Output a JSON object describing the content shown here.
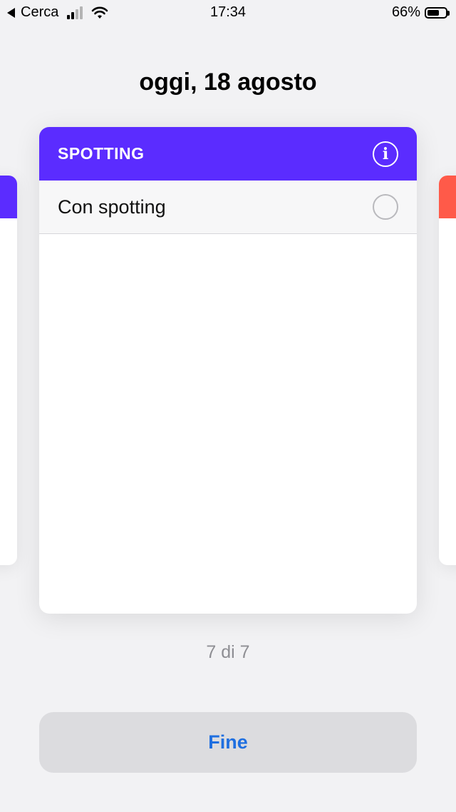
{
  "status_bar": {
    "back_app": "Cerca",
    "time": "17:34",
    "battery_text": "66%",
    "battery_level": 0.66
  },
  "date_title": "oggi, 18 agosto",
  "card": {
    "title": "SPOTTING",
    "header_color": "#5b2cff",
    "info_icon": "info-icon",
    "options": [
      {
        "label": "Con spotting",
        "selected": false
      }
    ]
  },
  "side_cards": {
    "left_color": "#5b2cff",
    "right_color": "#ff5a49"
  },
  "pager": "7 di 7",
  "done_button": {
    "label": "Fine",
    "color": "#1f6fe0"
  }
}
